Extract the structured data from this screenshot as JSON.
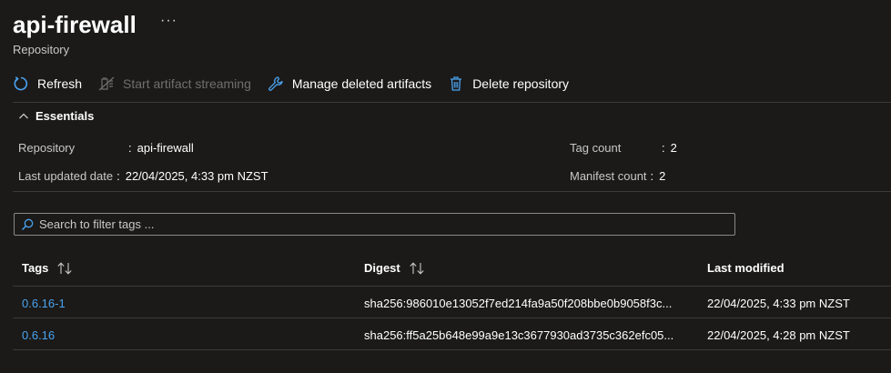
{
  "header": {
    "title": "api-firewall",
    "more": "···",
    "subtitle": "Repository"
  },
  "toolbar": {
    "refresh": "Refresh",
    "start_streaming": "Start artifact streaming",
    "manage_deleted": "Manage deleted artifacts",
    "delete_repo": "Delete repository"
  },
  "essentials": {
    "heading": "Essentials",
    "repository_label": "Repository",
    "repository_value": "api-firewall",
    "last_updated_label": "Last updated date",
    "last_updated_value": "22/04/2025, 4:33 pm NZST",
    "tag_count_label": "Tag count",
    "tag_count_value": "2",
    "manifest_count_label": "Manifest count",
    "manifest_count_value": "2",
    "separator": ":"
  },
  "search": {
    "placeholder": "Search to filter tags ..."
  },
  "table": {
    "headers": {
      "tags": "Tags",
      "digest": "Digest",
      "last_modified": "Last modified"
    },
    "rows": [
      {
        "tag": "0.6.16-1",
        "digest": "sha256:986010e13052f7ed214fa9a50f208bbe0b9058f3c...",
        "modified": "22/04/2025, 4:33 pm NZST"
      },
      {
        "tag": "0.6.16",
        "digest": "sha256:ff5a25b648e99a9e13c3677930ad3735c362efc05...",
        "modified": "22/04/2025, 4:28 pm NZST"
      }
    ]
  },
  "colors": {
    "background": "#1b1a19",
    "accent": "#4aa3ef",
    "divider": "#3b3a39"
  }
}
